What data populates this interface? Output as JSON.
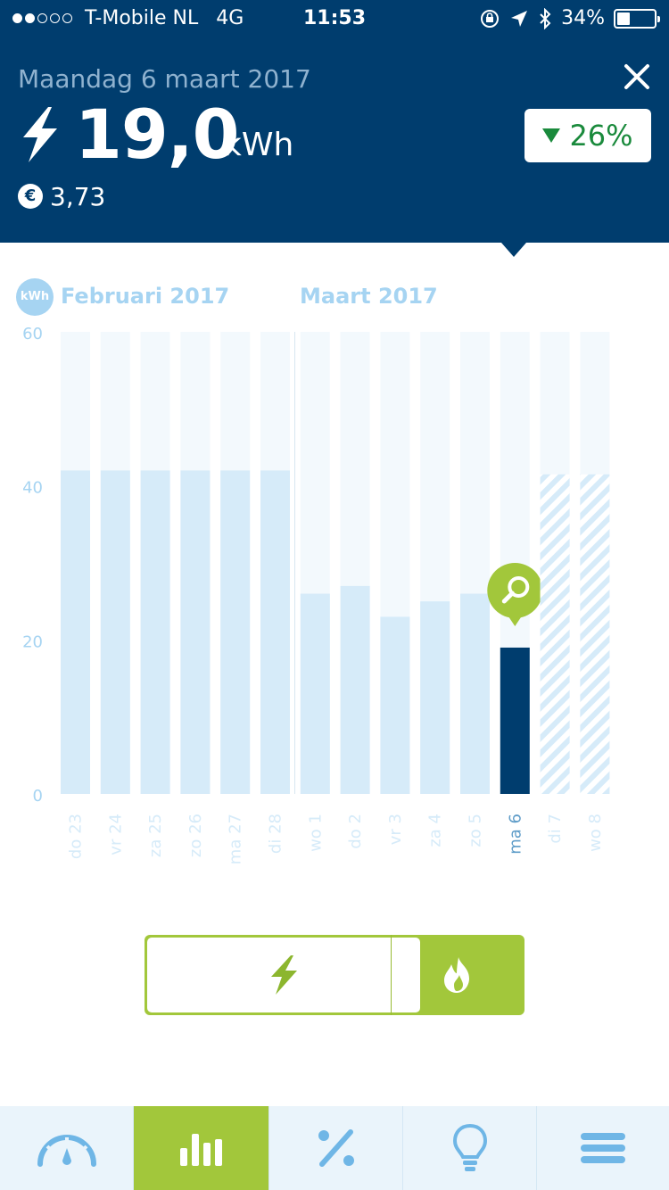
{
  "status_bar": {
    "carrier": "T-Mobile NL",
    "network": "4G",
    "time": "11:53",
    "battery": "34%"
  },
  "header": {
    "date": "Maandag 6 maart 2017",
    "value": "19,0",
    "unit": "kWh",
    "cost": "3,73",
    "currency_symbol": "€",
    "change_percent": "26%",
    "change_direction": "down"
  },
  "chart_labels": {
    "unit_badge": "kWh",
    "month_1": "Februari 2017",
    "month_2": "Maart 2017"
  },
  "chart_data": {
    "type": "bar",
    "ylabel": "kWh",
    "ylim": [
      0,
      60
    ],
    "yticks": [
      0,
      20,
      40,
      60
    ],
    "categories": [
      "do 23",
      "vr 24",
      "za 25",
      "zo 26",
      "ma 27",
      "di 28",
      "wo 1",
      "do 2",
      "vr 3",
      "za 4",
      "zo 5",
      "ma 6",
      "di 7",
      "wo 8"
    ],
    "values": [
      42,
      42,
      42,
      42,
      42,
      42,
      26,
      27,
      23,
      25,
      26,
      19.0,
      41.5,
      41.5
    ],
    "selected_index": 11,
    "forecast_indices": [
      12,
      13
    ],
    "colors": {
      "past": "#d6ebf9",
      "selected": "#003d6e",
      "forecast": "#d6ebf9",
      "background_column": "#f3f9fd",
      "axis_text": "#a6d4f2",
      "marker": "#a2c73b"
    }
  },
  "toggle": {
    "options": [
      "electricity",
      "electricity-and-gas",
      "gas"
    ],
    "selected": "electricity"
  },
  "tabbar": {
    "tabs": [
      "meter",
      "usage-chart",
      "percentage",
      "tips",
      "menu"
    ],
    "active": "usage-chart"
  }
}
